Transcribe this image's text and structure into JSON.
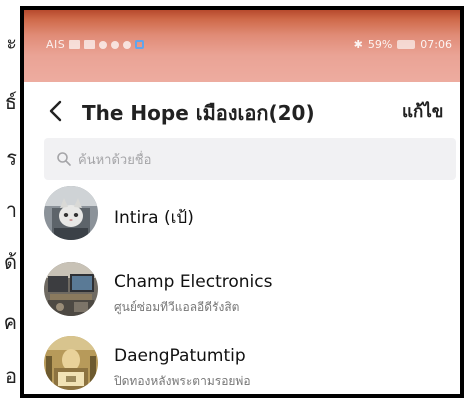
{
  "background_text": {
    "glyphs": [
      "ะ",
      "ธ์",
      "ร",
      "า",
      "ด้",
      "ค",
      "อ"
    ]
  },
  "status_bar": {
    "left_text": "AIS",
    "battery_text": "59%",
    "time": "07:06"
  },
  "header": {
    "title": "The Hope เมืองเอก(20)",
    "edit_label": "แก้ไข"
  },
  "search": {
    "placeholder": "ค้นหาด้วยชื่อ"
  },
  "contacts": [
    {
      "name": "Intira (เป้)",
      "subtitle": ""
    },
    {
      "name": "Champ Electronics",
      "subtitle": "ศูนย์ซ่อมทีวีแอลอีดีรังสิต"
    },
    {
      "name": "DaengPatumtip",
      "subtitle": "ปิดทองหลังพระตามรอยพ่อ"
    }
  ],
  "colors": {
    "status_bar_top": "#b74a2e",
    "status_bar_bottom": "#eeaea2",
    "search_bg": "#f1f1f3",
    "title_text": "#222222"
  }
}
